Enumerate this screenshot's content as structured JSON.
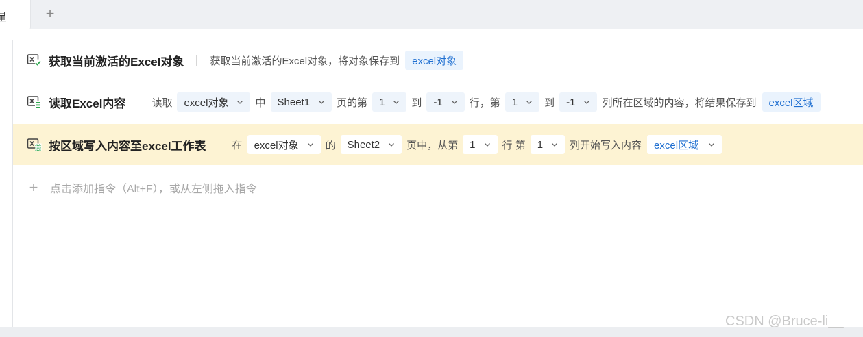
{
  "tabs": {
    "active_label": "星",
    "add_symbol": "+"
  },
  "commands": [
    {
      "title": "获取当前激活的Excel对象",
      "icon": "excel-get-icon",
      "parts": [
        {
          "t": "text",
          "v": "获取当前激活的Excel对象，将对象保存到"
        },
        {
          "t": "var",
          "v": "excel对象"
        }
      ]
    },
    {
      "title": "读取Excel内容",
      "icon": "excel-read-icon",
      "parts": [
        {
          "t": "text",
          "v": "读取"
        },
        {
          "t": "select",
          "v": "excel对象"
        },
        {
          "t": "text",
          "v": "中"
        },
        {
          "t": "select",
          "v": "Sheet1"
        },
        {
          "t": "text",
          "v": "页的第"
        },
        {
          "t": "select",
          "v": "1"
        },
        {
          "t": "text",
          "v": "到"
        },
        {
          "t": "select",
          "v": "-1"
        },
        {
          "t": "text",
          "v": "行，第"
        },
        {
          "t": "select",
          "v": "1"
        },
        {
          "t": "text",
          "v": "到"
        },
        {
          "t": "select",
          "v": "-1"
        },
        {
          "t": "text",
          "v": "列所在区域的内容，将结果保存到"
        },
        {
          "t": "var",
          "v": "excel区域"
        }
      ]
    },
    {
      "title": "按区域写入内容至excel工作表",
      "icon": "excel-write-icon",
      "highlighted": true,
      "parts": [
        {
          "t": "text",
          "v": "在"
        },
        {
          "t": "select",
          "v": "excel对象"
        },
        {
          "t": "text",
          "v": "的"
        },
        {
          "t": "select",
          "v": "Sheet2"
        },
        {
          "t": "text",
          "v": "页中，从第"
        },
        {
          "t": "select",
          "v": "1"
        },
        {
          "t": "text",
          "v": "行 第"
        },
        {
          "t": "select",
          "v": "1"
        },
        {
          "t": "text",
          "v": "列开始写入内容"
        },
        {
          "t": "varselect",
          "v": "excel区域"
        }
      ]
    }
  ],
  "add_hint": {
    "symbol": "+",
    "text": "点击添加指令（Alt+F），或从左侧拖入指令"
  },
  "watermark": "CSDN @Bruce-li__",
  "colors": {
    "highlight": "#fdf3d3",
    "variable": "#1f6fd1",
    "pill_bg": "#eef4fb",
    "icon_green": "#2fa84f"
  }
}
